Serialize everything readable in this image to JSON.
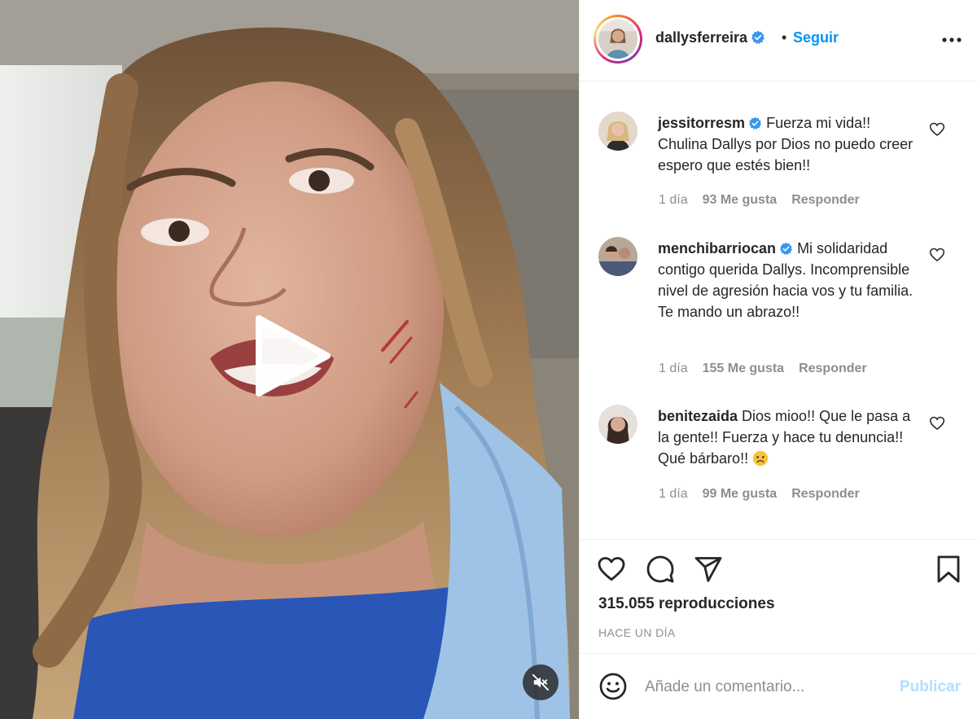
{
  "post": {
    "username": "dallysferreira",
    "verified": true,
    "separator": "•",
    "follow_label": "Seguir",
    "more_icon": "more-horizontal-icon"
  },
  "media": {
    "type": "video",
    "play_icon": "play-icon",
    "mute_icon": "muted-speaker-icon"
  },
  "comments": [
    {
      "username": "jessitorresm",
      "verified": true,
      "text": "Fuerza mi vida!! Chulina Dallys por Dios no puedo creer espero que estés bien!!",
      "time": "1 día",
      "likes": "93 Me gusta",
      "reply": "Responder"
    },
    {
      "username": "menchibarriocan",
      "verified": true,
      "text": "Mi solidaridad contigo querida Dallys. Incomprensible nivel de agresión hacia vos y tu familia. Te mando un abrazo!!",
      "time": "1 día",
      "likes": "155 Me gusta",
      "reply": "Responder"
    },
    {
      "username": "benitezaida",
      "verified": false,
      "text": "Dios mioo!! Que le pasa a la gente!! Fuerza y hace tu denuncia!! Qué bárbaro!!",
      "emoji": "sad-face",
      "time": "1 día",
      "likes": "99 Me gusta",
      "reply": "Responder"
    }
  ],
  "actions": {
    "icons": [
      "heart-icon",
      "comment-icon",
      "share-icon",
      "bookmark-icon"
    ],
    "views_count": "315.055",
    "views_label": "reproducciones",
    "posted_ago": "HACE UN DÍA"
  },
  "composer": {
    "placeholder": "Añade un comentario...",
    "value": "",
    "publish_label": "Publicar"
  },
  "colors": {
    "link_blue": "#0095f6",
    "publish_disabled": "#b2dffc",
    "muted_text": "#8e8e8e",
    "verified_blue": "#3897f0",
    "border": "#efefef"
  }
}
